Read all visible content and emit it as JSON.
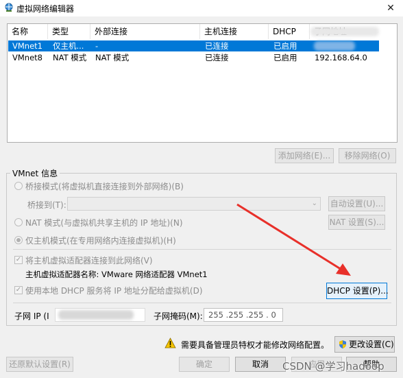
{
  "window": {
    "title": "虚拟网络编辑器",
    "close": "✕"
  },
  "table": {
    "headers": [
      "名称",
      "类型",
      "外部连接",
      "主机连接",
      "DHCP",
      "子网地址"
    ],
    "rows": [
      {
        "name": "VMnet1",
        "type": "仅主机...",
        "external": "-",
        "host": "已连接",
        "dhcp": "已启用",
        "subnet": ""
      },
      {
        "name": "VMnet8",
        "type": "NAT 模式",
        "external": "NAT 模式",
        "host": "已连接",
        "dhcp": "已启用",
        "subnet": "192.168.64.0"
      }
    ]
  },
  "actions": {
    "add_network": "添加网络(E)...",
    "remove_network": "移除网络(O)"
  },
  "vmnet_info": {
    "legend": "VMnet 信息",
    "bridged_mode": "桥接模式(将虚拟机直接连接到外部网络)(B)",
    "bridged_to_label": "桥接到(T):",
    "auto_settings": "自动设置(U)...",
    "nat_mode": "NAT 模式(与虚拟机共享主机的 IP 地址)(N)",
    "nat_settings": "NAT 设置(S)...",
    "host_only_mode": "仅主机模式(在专用网络内连接虚拟机)(H)",
    "connect_adapter": "将主机虚拟适配器连接到此网络(V)",
    "adapter_name": "主机虚拟适配器名称: VMware 网络适配器 VMnet1",
    "use_dhcp": "使用本地 DHCP 服务将 IP 地址分配给虚拟机(D)",
    "dhcp_settings": "DHCP 设置(P)...",
    "subnet_ip_label": "子网 IP (I",
    "subnet_mask_label": "子网掩码(M):",
    "subnet_mask_value": "255 .255 .255 . 0"
  },
  "footer": {
    "admin_warning": "需要具备管理员特权才能修改网络配置。",
    "change_settings": "更改设置(C)",
    "restore_defaults": "还原默认设置(R)",
    "ok": "确定",
    "cancel": "取消",
    "apply": "应用",
    "help": "帮助"
  },
  "watermark": "CSDN @学习hadoop",
  "colors": {
    "selection": "#0078d7",
    "arrow": "#e8302a",
    "warning": "#f5c400"
  }
}
